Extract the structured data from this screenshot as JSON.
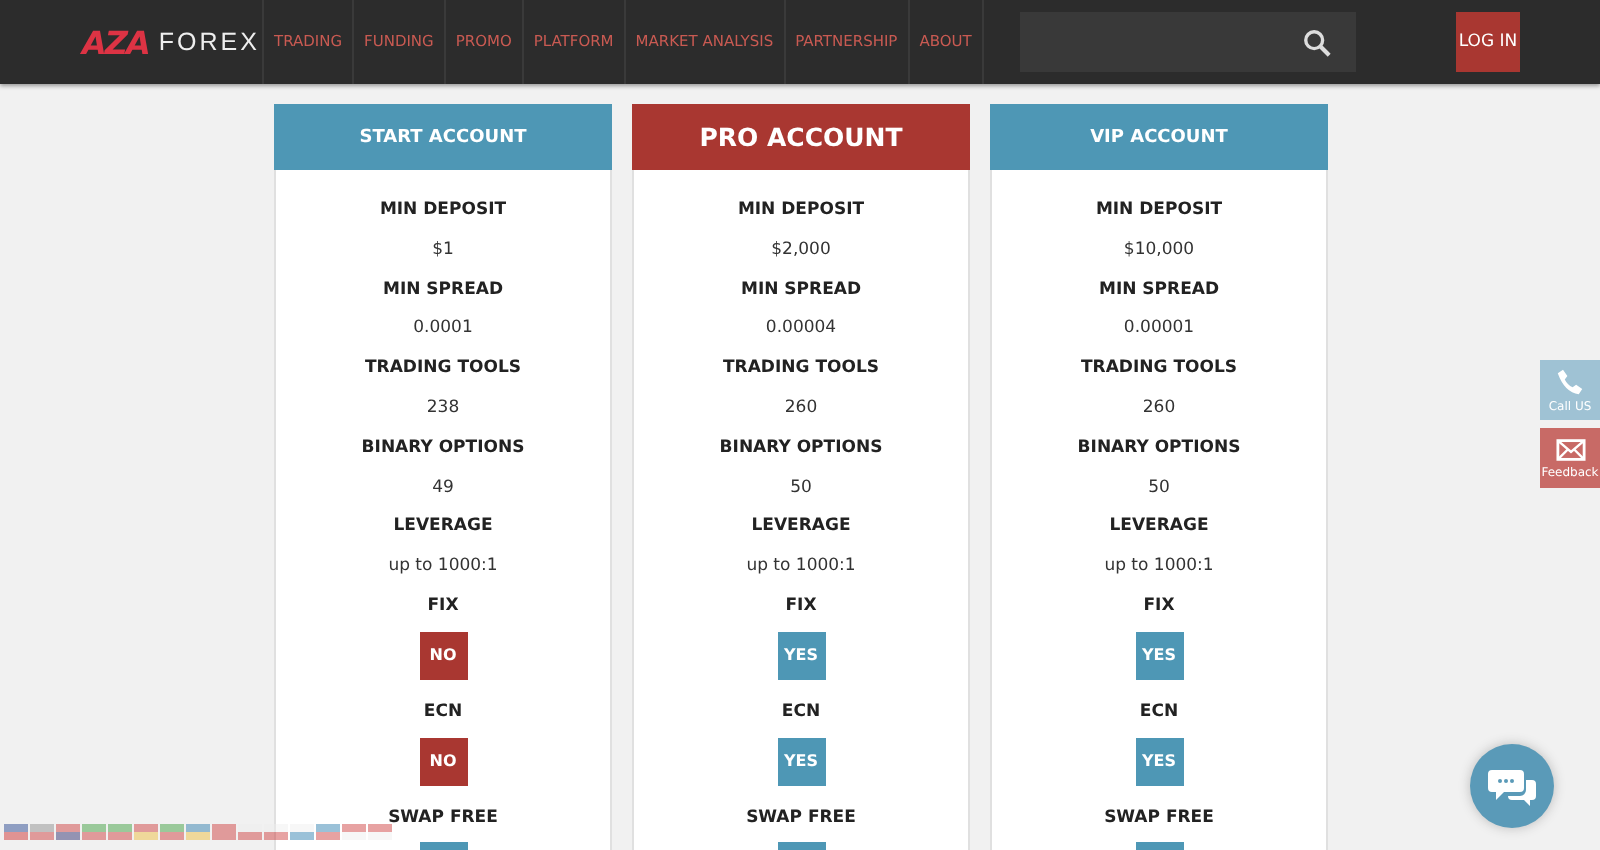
{
  "brand": {
    "mark": "AZA",
    "name": "FOREX"
  },
  "nav": [
    "TRADING",
    "FUNDING",
    "PROMO",
    "PLATFORM",
    "MARKET ANALYSIS",
    "PARTNERSHIP",
    "ABOUT"
  ],
  "login": "LOG IN",
  "plans": [
    {
      "name": "START ACCOUNT",
      "featured": false,
      "features": [
        {
          "kind": "text",
          "label": "MIN DEPOSIT",
          "value": "$1"
        },
        {
          "kind": "text",
          "label": "MIN SPREAD",
          "value": "0.0001"
        },
        {
          "kind": "text",
          "label": "TRADING TOOLS",
          "value": "238"
        },
        {
          "kind": "text",
          "label": "BINARY OPTIONS",
          "value": "49"
        },
        {
          "kind": "text",
          "label": "LEVERAGE",
          "value": "up to 1000:1"
        },
        {
          "kind": "flag",
          "label": "FIX",
          "value": "NO",
          "on": false
        },
        {
          "kind": "flag",
          "label": "ECN",
          "value": "NO",
          "on": false
        },
        {
          "kind": "flag",
          "label": "SWAP FREE",
          "on": true
        }
      ]
    },
    {
      "name": "PRO ACCOUNT",
      "featured": true,
      "features": [
        {
          "kind": "text",
          "label": "MIN DEPOSIT",
          "value": "$2,000"
        },
        {
          "kind": "text",
          "label": "MIN SPREAD",
          "value": "0.00004"
        },
        {
          "kind": "text",
          "label": "TRADING TOOLS",
          "value": "260"
        },
        {
          "kind": "text",
          "label": "BINARY OPTIONS",
          "value": "50"
        },
        {
          "kind": "text",
          "label": "LEVERAGE",
          "value": "up to 1000:1"
        },
        {
          "kind": "flag",
          "label": "FIX",
          "value": "YES",
          "on": true
        },
        {
          "kind": "flag",
          "label": "ECN",
          "value": "YES",
          "on": true
        },
        {
          "kind": "flag",
          "label": "SWAP FREE",
          "on": true
        }
      ]
    },
    {
      "name": "VIP ACCOUNT",
      "featured": false,
      "features": [
        {
          "kind": "text",
          "label": "MIN DEPOSIT",
          "value": "$10,000"
        },
        {
          "kind": "text",
          "label": "MIN SPREAD",
          "value": "0.00001"
        },
        {
          "kind": "text",
          "label": "TRADING TOOLS",
          "value": "260"
        },
        {
          "kind": "text",
          "label": "BINARY OPTIONS",
          "value": "50"
        },
        {
          "kind": "text",
          "label": "LEVERAGE",
          "value": "up to 1000:1"
        },
        {
          "kind": "flag",
          "label": "FIX",
          "value": "YES",
          "on": true
        },
        {
          "kind": "flag",
          "label": "ECN",
          "value": "YES",
          "on": true
        },
        {
          "kind": "flag",
          "label": "SWAP FREE",
          "on": true
        }
      ]
    }
  ],
  "side_buttons": [
    {
      "kind": "call",
      "label": "Call US"
    },
    {
      "kind": "feedback",
      "label": "Feedback"
    }
  ]
}
